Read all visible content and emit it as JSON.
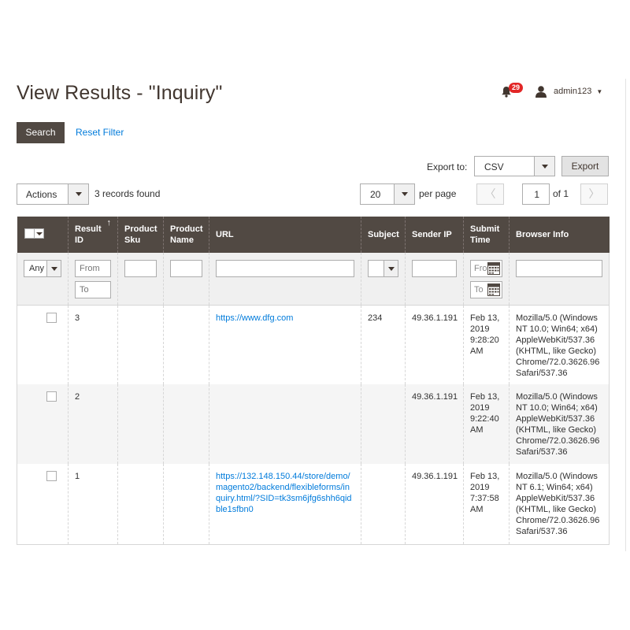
{
  "page_title": "View Results - \"Inquiry\"",
  "header": {
    "notifications_count": "29",
    "user_name": "admin123"
  },
  "toolbar": {
    "search_label": "Search",
    "reset_label": "Reset Filter",
    "export_label": "Export to:",
    "export_format": "CSV",
    "export_button": "Export",
    "actions_label": "Actions",
    "records_found": "3 records found",
    "per_page_value": "20",
    "per_page_label": "per page",
    "current_page": "1",
    "page_total": "of 1"
  },
  "columns": {
    "result_id": "Result ID",
    "product_sku": "Product Sku",
    "product_name": "Product Name",
    "url": "URL",
    "subject": "Subject",
    "sender_ip": "Sender IP",
    "submit_time": "Submit Time",
    "browser_info": "Browser Info"
  },
  "filters": {
    "any": "Any",
    "from": "From",
    "to": "To",
    "date_from": "From",
    "date_to": "To"
  },
  "rows": [
    {
      "id": "3",
      "sku": "",
      "name": "",
      "url": "https://www.dfg.com",
      "subject": "234",
      "ip": "49.36.1.191",
      "time": "Feb 13, 2019 9:28:20 AM",
      "browser": "Mozilla/5.0 (Windows NT 10.0; Win64; x64) AppleWebKit/537.36 (KHTML, like Gecko) Chrome/72.0.3626.96 Safari/537.36"
    },
    {
      "id": "2",
      "sku": "",
      "name": "",
      "url": "",
      "subject": "",
      "ip": "49.36.1.191",
      "time": "Feb 13, 2019 9:22:40 AM",
      "browser": "Mozilla/5.0 (Windows NT 10.0; Win64; x64) AppleWebKit/537.36 (KHTML, like Gecko) Chrome/72.0.3626.96 Safari/537.36"
    },
    {
      "id": "1",
      "sku": "",
      "name": "",
      "url": "https://132.148.150.44/store/demo/magento2/backend/flexibleforms/inquiry.html/?SID=tk3sm6jfg6shh6qidble1sfbn0",
      "subject": "",
      "ip": "49.36.1.191",
      "time": "Feb 13, 2019 7:37:58 AM",
      "browser": "Mozilla/5.0 (Windows NT 6.1; Win64; x64) AppleWebKit/537.36 (KHTML, like Gecko) Chrome/72.0.3626.96 Safari/537.36"
    }
  ],
  "colors": {
    "header_bg": "#514943",
    "link": "#007bdb",
    "badge": "#e22626"
  },
  "icons": {
    "notifications": "bell-icon",
    "user": "user-icon",
    "calendar": "calendar-icon"
  }
}
